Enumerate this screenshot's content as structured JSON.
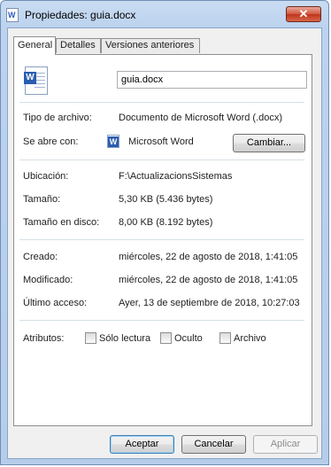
{
  "window": {
    "title": "Propiedades: guia.docx",
    "close_glyph": "✕"
  },
  "tabs": [
    {
      "label": "General",
      "active": true
    },
    {
      "label": "Detalles",
      "active": false
    },
    {
      "label": "Versiones anteriores",
      "active": false
    }
  ],
  "file": {
    "name": "guia.docx",
    "icon": "word-document-icon"
  },
  "type": {
    "label": "Tipo de archivo:",
    "value": "Documento de Microsoft Word (.docx)"
  },
  "opens_with": {
    "label": "Se abre con:",
    "app": "Microsoft Word",
    "change_button": "Cambiar..."
  },
  "location": {
    "label": "Ubicación:",
    "value": "F:\\ActualizacionsSistemas"
  },
  "size": {
    "label": "Tamaño:",
    "value": "5,30 KB (5.436 bytes)"
  },
  "size_on_disk": {
    "label": "Tamaño en disco:",
    "value": "8,00 KB (8.192 bytes)"
  },
  "created": {
    "label": "Creado:",
    "value": "miércoles, 22 de agosto de 2018, 1:41:05"
  },
  "modified": {
    "label": "Modificado:",
    "value": "miércoles, 22 de agosto de 2018, 1:41:05"
  },
  "accessed": {
    "label": "Último acceso:",
    "value": "Ayer, 13 de septiembre de 2018, 10:27:03"
  },
  "attributes": {
    "label": "Atributos:",
    "read_only": {
      "label": "Sólo lectura",
      "checked": false
    },
    "hidden": {
      "label": "Oculto",
      "checked": false
    },
    "archive": {
      "label": "Archivo",
      "checked": false
    }
  },
  "footer": {
    "ok": "Aceptar",
    "cancel": "Cancelar",
    "apply": "Aplicar"
  },
  "colors": {
    "word_blue": "#2a5db0",
    "close_red": "#c0341b",
    "frame": "#b6cdea"
  }
}
